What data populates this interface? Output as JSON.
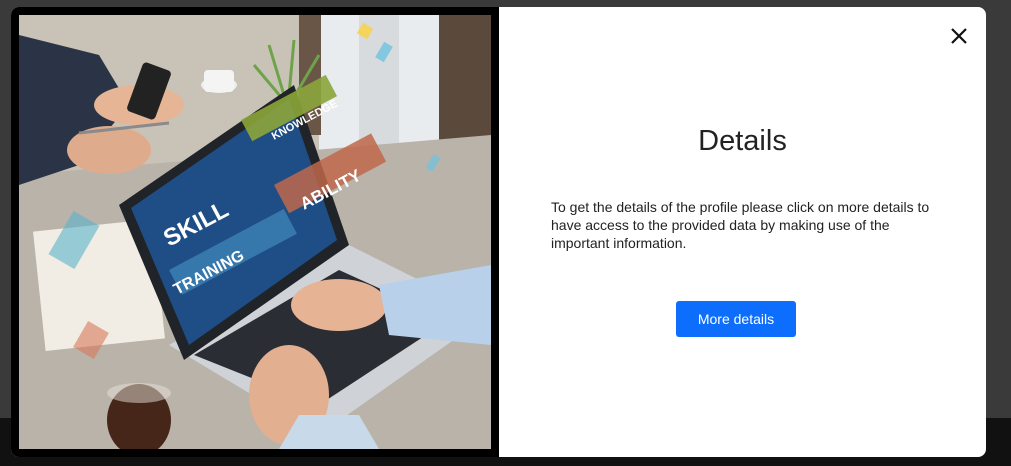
{
  "modal": {
    "title": "Details",
    "description": "To get the details of the profile please click on more details to have access to the provided data by making use of the important information.",
    "button_label": "More details",
    "close_icon": "close-icon"
  },
  "image": {
    "labels": {
      "skill": "SKILL",
      "training": "TRAINING",
      "knowledge": "KNOWLEDGE",
      "ability": "ABILITY"
    }
  },
  "colors": {
    "accent": "#0d6efd",
    "overlay": "#3a3a3a"
  }
}
